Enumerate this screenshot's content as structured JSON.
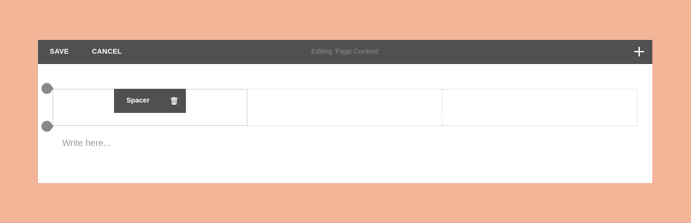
{
  "toolbar": {
    "save_label": "SAVE",
    "cancel_label": "CANCEL",
    "title": "Editing 'Page Content'",
    "add_icon": "plus-icon"
  },
  "block": {
    "label": "Spacer",
    "delete_icon": "trash-icon",
    "handle_icon": "drag-handle"
  },
  "editor": {
    "placeholder": "Write here..."
  },
  "colors": {
    "background": "#f2b598",
    "toolbar": "#505050",
    "panel": "#ffffff"
  }
}
